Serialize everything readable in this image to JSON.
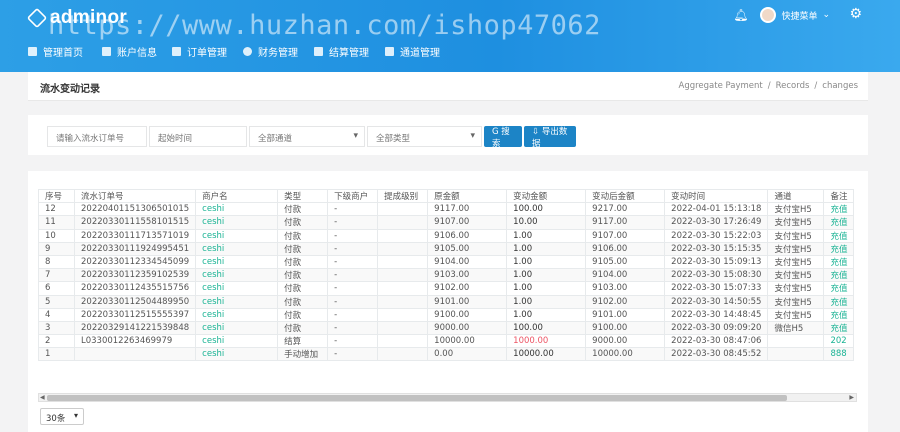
{
  "header": {
    "logo": "adminor",
    "watermark": "https://www.huzhan.com/ishop47062",
    "nav": [
      "管理首页",
      "账户信息",
      "订单管理",
      "财务管理",
      "结算管理",
      "通道管理"
    ],
    "user_menu": "快捷菜单",
    "icons": [
      "bell-icon",
      "avatar",
      "gear-icon"
    ]
  },
  "page": {
    "title": "流水变动记录",
    "breadcrumb": [
      "Aggregate Payment",
      "/",
      "Records",
      "/",
      "changes"
    ]
  },
  "filters": {
    "order_placeholder": "请输入流水订单号",
    "date_placeholder": "起始时间",
    "channel_select": "全部通道",
    "type_select": "全部类型",
    "search_btn": "G 搜索",
    "export_btn": "⇩ 导出数据"
  },
  "table": {
    "columns": [
      "序号",
      "流水订单号",
      "商户名",
      "类型",
      "下级商户",
      "提成级别",
      "原金额",
      "变动金额",
      "变动后金额",
      "变动时间",
      "通道",
      "备注"
    ],
    "rows": [
      [
        "12",
        "20220401151306501015",
        "ceshi",
        "付款",
        "-",
        "",
        "9117.00",
        "100.00",
        "9217.00",
        "2022-04-01 15:13:18",
        "支付宝H5",
        "充值"
      ],
      [
        "11",
        "20220330111558101515",
        "ceshi",
        "付款",
        "-",
        "",
        "9107.00",
        "10.00",
        "9117.00",
        "2022-03-30 17:26:49",
        "支付宝H5",
        "充值"
      ],
      [
        "10",
        "20220330111713571019",
        "ceshi",
        "付款",
        "-",
        "",
        "9106.00",
        "1.00",
        "9107.00",
        "2022-03-30 15:22:03",
        "支付宝H5",
        "充值"
      ],
      [
        "9",
        "20220330111924995451",
        "ceshi",
        "付款",
        "-",
        "",
        "9105.00",
        "1.00",
        "9106.00",
        "2022-03-30 15:15:35",
        "支付宝H5",
        "充值"
      ],
      [
        "8",
        "20220330112334545099",
        "ceshi",
        "付款",
        "-",
        "",
        "9104.00",
        "1.00",
        "9105.00",
        "2022-03-30 15:09:13",
        "支付宝H5",
        "充值"
      ],
      [
        "7",
        "20220330112359102539",
        "ceshi",
        "付款",
        "-",
        "",
        "9103.00",
        "1.00",
        "9104.00",
        "2022-03-30 15:08:30",
        "支付宝H5",
        "充值"
      ],
      [
        "6",
        "20220330112435515756",
        "ceshi",
        "付款",
        "-",
        "",
        "9102.00",
        "1.00",
        "9103.00",
        "2022-03-30 15:07:33",
        "支付宝H5",
        "充值"
      ],
      [
        "5",
        "20220330112504489950",
        "ceshi",
        "付款",
        "-",
        "",
        "9101.00",
        "1.00",
        "9102.00",
        "2022-03-30 14:50:55",
        "支付宝H5",
        "充值"
      ],
      [
        "4",
        "20220330112515555397",
        "ceshi",
        "付款",
        "-",
        "",
        "9100.00",
        "1.00",
        "9101.00",
        "2022-03-30 14:48:45",
        "支付宝H5",
        "充值"
      ],
      [
        "3",
        "20220329141221539848",
        "ceshi",
        "付款",
        "-",
        "",
        "9000.00",
        "100.00",
        "9100.00",
        "2022-03-30 09:09:20",
        "微信H5",
        "充值"
      ],
      [
        "2",
        "L0330012263469979",
        "ceshi",
        "结算",
        "-",
        "",
        "10000.00",
        "1000.00",
        "9000.00",
        "2022-03-30 08:47:06",
        "",
        "202"
      ],
      [
        "1",
        "",
        "ceshi",
        "手动增加",
        "-",
        "",
        "0.00",
        "10000.00",
        "10000.00",
        "2022-03-30 08:45:52",
        "",
        "888"
      ]
    ],
    "red_amount_row": 10
  },
  "pager": {
    "page_size": "30条"
  },
  "colors": {
    "header_blue": "#1e8fe0",
    "button_blue": "#1c84c6",
    "green": "#1ab394",
    "red": "#ed5565"
  }
}
